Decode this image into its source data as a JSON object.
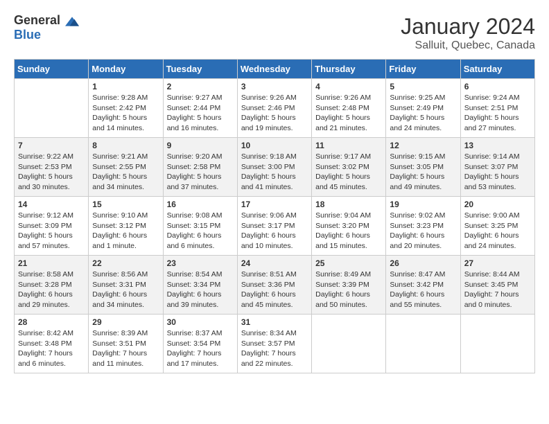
{
  "header": {
    "logo_general": "General",
    "logo_blue": "Blue",
    "month": "January 2024",
    "location": "Salluit, Quebec, Canada"
  },
  "days_of_week": [
    "Sunday",
    "Monday",
    "Tuesday",
    "Wednesday",
    "Thursday",
    "Friday",
    "Saturday"
  ],
  "weeks": [
    [
      {
        "day": "",
        "sunrise": "",
        "sunset": "",
        "daylight": ""
      },
      {
        "day": "1",
        "sunrise": "Sunrise: 9:28 AM",
        "sunset": "Sunset: 2:42 PM",
        "daylight": "Daylight: 5 hours and 14 minutes."
      },
      {
        "day": "2",
        "sunrise": "Sunrise: 9:27 AM",
        "sunset": "Sunset: 2:44 PM",
        "daylight": "Daylight: 5 hours and 16 minutes."
      },
      {
        "day": "3",
        "sunrise": "Sunrise: 9:26 AM",
        "sunset": "Sunset: 2:46 PM",
        "daylight": "Daylight: 5 hours and 19 minutes."
      },
      {
        "day": "4",
        "sunrise": "Sunrise: 9:26 AM",
        "sunset": "Sunset: 2:48 PM",
        "daylight": "Daylight: 5 hours and 21 minutes."
      },
      {
        "day": "5",
        "sunrise": "Sunrise: 9:25 AM",
        "sunset": "Sunset: 2:49 PM",
        "daylight": "Daylight: 5 hours and 24 minutes."
      },
      {
        "day": "6",
        "sunrise": "Sunrise: 9:24 AM",
        "sunset": "Sunset: 2:51 PM",
        "daylight": "Daylight: 5 hours and 27 minutes."
      }
    ],
    [
      {
        "day": "7",
        "sunrise": "Sunrise: 9:22 AM",
        "sunset": "Sunset: 2:53 PM",
        "daylight": "Daylight: 5 hours and 30 minutes."
      },
      {
        "day": "8",
        "sunrise": "Sunrise: 9:21 AM",
        "sunset": "Sunset: 2:55 PM",
        "daylight": "Daylight: 5 hours and 34 minutes."
      },
      {
        "day": "9",
        "sunrise": "Sunrise: 9:20 AM",
        "sunset": "Sunset: 2:58 PM",
        "daylight": "Daylight: 5 hours and 37 minutes."
      },
      {
        "day": "10",
        "sunrise": "Sunrise: 9:18 AM",
        "sunset": "Sunset: 3:00 PM",
        "daylight": "Daylight: 5 hours and 41 minutes."
      },
      {
        "day": "11",
        "sunrise": "Sunrise: 9:17 AM",
        "sunset": "Sunset: 3:02 PM",
        "daylight": "Daylight: 5 hours and 45 minutes."
      },
      {
        "day": "12",
        "sunrise": "Sunrise: 9:15 AM",
        "sunset": "Sunset: 3:05 PM",
        "daylight": "Daylight: 5 hours and 49 minutes."
      },
      {
        "day": "13",
        "sunrise": "Sunrise: 9:14 AM",
        "sunset": "Sunset: 3:07 PM",
        "daylight": "Daylight: 5 hours and 53 minutes."
      }
    ],
    [
      {
        "day": "14",
        "sunrise": "Sunrise: 9:12 AM",
        "sunset": "Sunset: 3:09 PM",
        "daylight": "Daylight: 5 hours and 57 minutes."
      },
      {
        "day": "15",
        "sunrise": "Sunrise: 9:10 AM",
        "sunset": "Sunset: 3:12 PM",
        "daylight": "Daylight: 6 hours and 1 minute."
      },
      {
        "day": "16",
        "sunrise": "Sunrise: 9:08 AM",
        "sunset": "Sunset: 3:15 PM",
        "daylight": "Daylight: 6 hours and 6 minutes."
      },
      {
        "day": "17",
        "sunrise": "Sunrise: 9:06 AM",
        "sunset": "Sunset: 3:17 PM",
        "daylight": "Daylight: 6 hours and 10 minutes."
      },
      {
        "day": "18",
        "sunrise": "Sunrise: 9:04 AM",
        "sunset": "Sunset: 3:20 PM",
        "daylight": "Daylight: 6 hours and 15 minutes."
      },
      {
        "day": "19",
        "sunrise": "Sunrise: 9:02 AM",
        "sunset": "Sunset: 3:23 PM",
        "daylight": "Daylight: 6 hours and 20 minutes."
      },
      {
        "day": "20",
        "sunrise": "Sunrise: 9:00 AM",
        "sunset": "Sunset: 3:25 PM",
        "daylight": "Daylight: 6 hours and 24 minutes."
      }
    ],
    [
      {
        "day": "21",
        "sunrise": "Sunrise: 8:58 AM",
        "sunset": "Sunset: 3:28 PM",
        "daylight": "Daylight: 6 hours and 29 minutes."
      },
      {
        "day": "22",
        "sunrise": "Sunrise: 8:56 AM",
        "sunset": "Sunset: 3:31 PM",
        "daylight": "Daylight: 6 hours and 34 minutes."
      },
      {
        "day": "23",
        "sunrise": "Sunrise: 8:54 AM",
        "sunset": "Sunset: 3:34 PM",
        "daylight": "Daylight: 6 hours and 39 minutes."
      },
      {
        "day": "24",
        "sunrise": "Sunrise: 8:51 AM",
        "sunset": "Sunset: 3:36 PM",
        "daylight": "Daylight: 6 hours and 45 minutes."
      },
      {
        "day": "25",
        "sunrise": "Sunrise: 8:49 AM",
        "sunset": "Sunset: 3:39 PM",
        "daylight": "Daylight: 6 hours and 50 minutes."
      },
      {
        "day": "26",
        "sunrise": "Sunrise: 8:47 AM",
        "sunset": "Sunset: 3:42 PM",
        "daylight": "Daylight: 6 hours and 55 minutes."
      },
      {
        "day": "27",
        "sunrise": "Sunrise: 8:44 AM",
        "sunset": "Sunset: 3:45 PM",
        "daylight": "Daylight: 7 hours and 0 minutes."
      }
    ],
    [
      {
        "day": "28",
        "sunrise": "Sunrise: 8:42 AM",
        "sunset": "Sunset: 3:48 PM",
        "daylight": "Daylight: 7 hours and 6 minutes."
      },
      {
        "day": "29",
        "sunrise": "Sunrise: 8:39 AM",
        "sunset": "Sunset: 3:51 PM",
        "daylight": "Daylight: 7 hours and 11 minutes."
      },
      {
        "day": "30",
        "sunrise": "Sunrise: 8:37 AM",
        "sunset": "Sunset: 3:54 PM",
        "daylight": "Daylight: 7 hours and 17 minutes."
      },
      {
        "day": "31",
        "sunrise": "Sunrise: 8:34 AM",
        "sunset": "Sunset: 3:57 PM",
        "daylight": "Daylight: 7 hours and 22 minutes."
      },
      {
        "day": "",
        "sunrise": "",
        "sunset": "",
        "daylight": ""
      },
      {
        "day": "",
        "sunrise": "",
        "sunset": "",
        "daylight": ""
      },
      {
        "day": "",
        "sunrise": "",
        "sunset": "",
        "daylight": ""
      }
    ]
  ]
}
